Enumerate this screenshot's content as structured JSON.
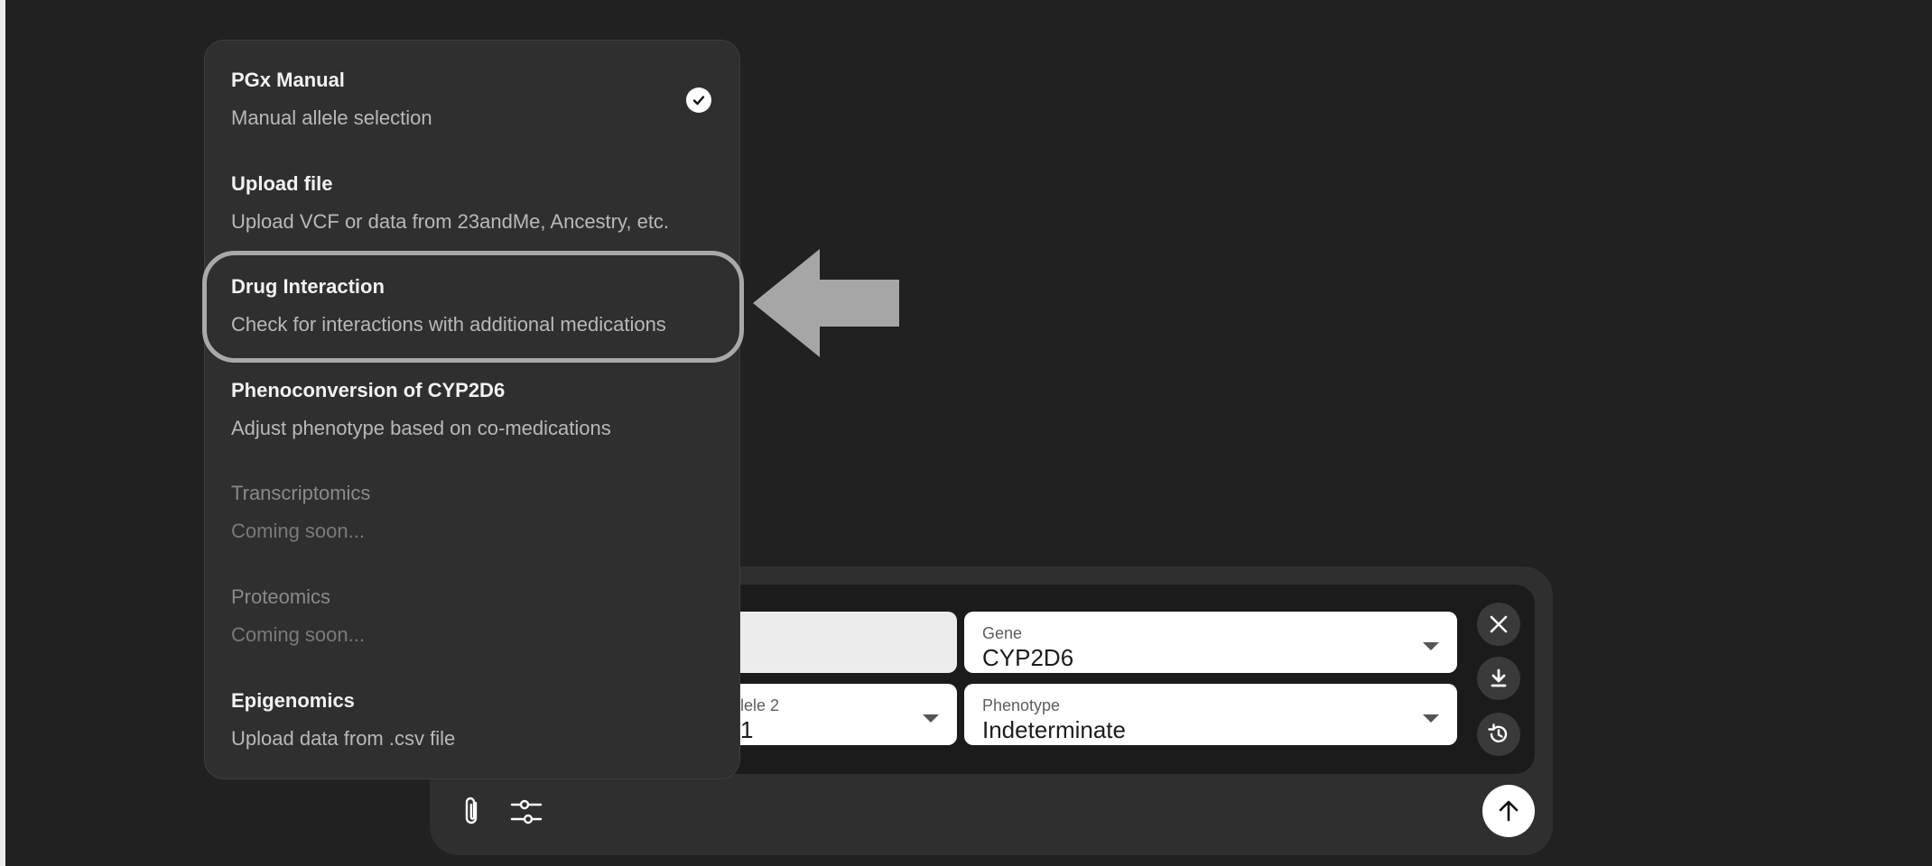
{
  "menu": {
    "items": [
      {
        "title": "PGx Manual",
        "desc": "Manual allele selection",
        "selected": true,
        "enabled": true
      },
      {
        "title": "Upload file",
        "desc": "Upload VCF or data from 23andMe, Ancestry, etc.",
        "enabled": true
      },
      {
        "title": "Drug Interaction",
        "desc": "Check for interactions with additional medications",
        "enabled": true,
        "highlighted": true
      },
      {
        "title": "Phenoconversion of CYP2D6",
        "desc": "Adjust phenotype based on co-medications",
        "enabled": true
      },
      {
        "title": "Transcriptomics",
        "desc": "Coming soon...",
        "enabled": false
      },
      {
        "title": "Proteomics",
        "desc": "Coming soon...",
        "enabled": false
      },
      {
        "title": "Epigenomics",
        "desc": "Upload data from .csv file",
        "enabled": true
      }
    ]
  },
  "form": {
    "gene": {
      "label": "Gene",
      "value": "CYP2D6"
    },
    "allele2": {
      "label": "llele 2",
      "value": "1"
    },
    "phenotype": {
      "label": "Phenotype",
      "value": "Indeterminate"
    }
  },
  "icons": {
    "check": "check-icon",
    "close": "close-icon",
    "download": "download-icon",
    "history": "history-icon",
    "attach": "paperclip-icon",
    "settings": "sliders-icon",
    "send": "arrow-up-icon",
    "annotation_arrow": "arrow-left-icon"
  },
  "colors": {
    "background": "#212121",
    "panel": "#2f2f2f",
    "highlight": "#a9a9a9"
  }
}
